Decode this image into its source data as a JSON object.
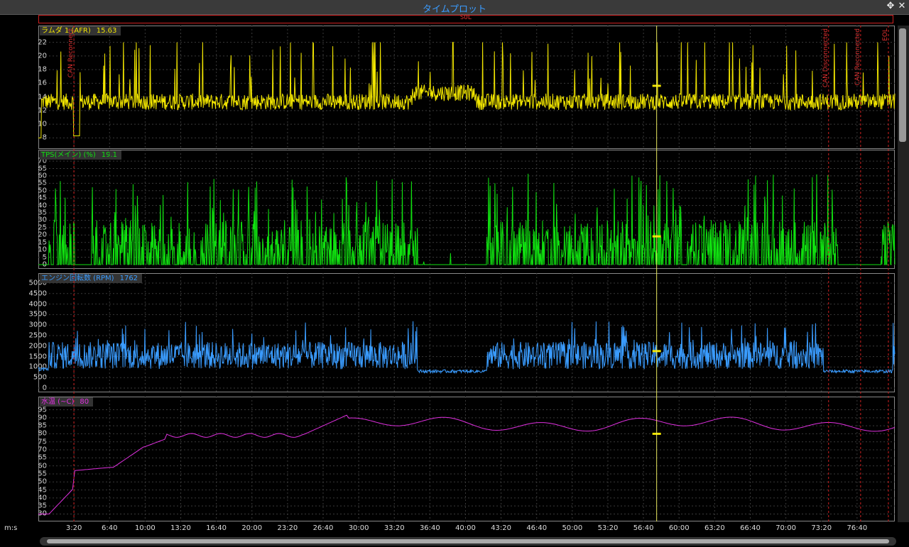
{
  "window": {
    "title": "タイムプロット",
    "move_icon": "✥",
    "close_icon": "✕"
  },
  "sol_label": "SOL",
  "markers": [
    {
      "label": "CAN Reconnect",
      "t": 3.33
    },
    {
      "label": "CAN Disconnected",
      "t": 74.0
    },
    {
      "label": "CAN Reconnected",
      "t": 77.0
    },
    {
      "label": "EOL",
      "t": 79.6
    }
  ],
  "cursor_time": 57.9,
  "x_axis": {
    "unit": "m:s",
    "ticks": [
      "3:20",
      "6:40",
      "10:00",
      "13:20",
      "16:40",
      "20:00",
      "23:20",
      "26:40",
      "30:00",
      "33:20",
      "36:40",
      "40:00",
      "43:20",
      "46:40",
      "50:00",
      "53:20",
      "56:40",
      "60:00",
      "63:20",
      "66:40",
      "70:00",
      "73:20",
      "76:40"
    ]
  },
  "channels": [
    {
      "name": "ラムダ 1 (AFR)",
      "value": "15.63",
      "color": "#f2e600",
      "yticks": [
        "22",
        "20",
        "18",
        "16",
        "14",
        "12",
        "10",
        "8"
      ],
      "ymin": 7,
      "ymax": 23
    },
    {
      "name": "TPS(メイン) (%)",
      "value": "19.1",
      "color": "#10e010",
      "yticks": [
        "70",
        "65",
        "60",
        "55",
        "50",
        "45",
        "40",
        "35",
        "30",
        "25",
        "20",
        "15",
        "10",
        "5",
        "0"
      ],
      "ymin": 0,
      "ymax": 71
    },
    {
      "name": "エンジン回転数 (RPM)",
      "value": "1762",
      "color": "#3a9cff",
      "yticks": [
        "5000",
        "4500",
        "4000",
        "3500",
        "3000",
        "2500",
        "2000",
        "1500",
        "1000",
        "500",
        "0"
      ],
      "ymin": 0,
      "ymax": 5000
    },
    {
      "name": "水温 (~C)",
      "value": "80",
      "color": "#e030e0",
      "yticks": [
        "95",
        "90",
        "85",
        "80",
        "75",
        "70",
        "65",
        "60",
        "55",
        "50",
        "45",
        "40",
        "35",
        "30"
      ],
      "ymin": 28,
      "ymax": 97
    }
  ]
}
